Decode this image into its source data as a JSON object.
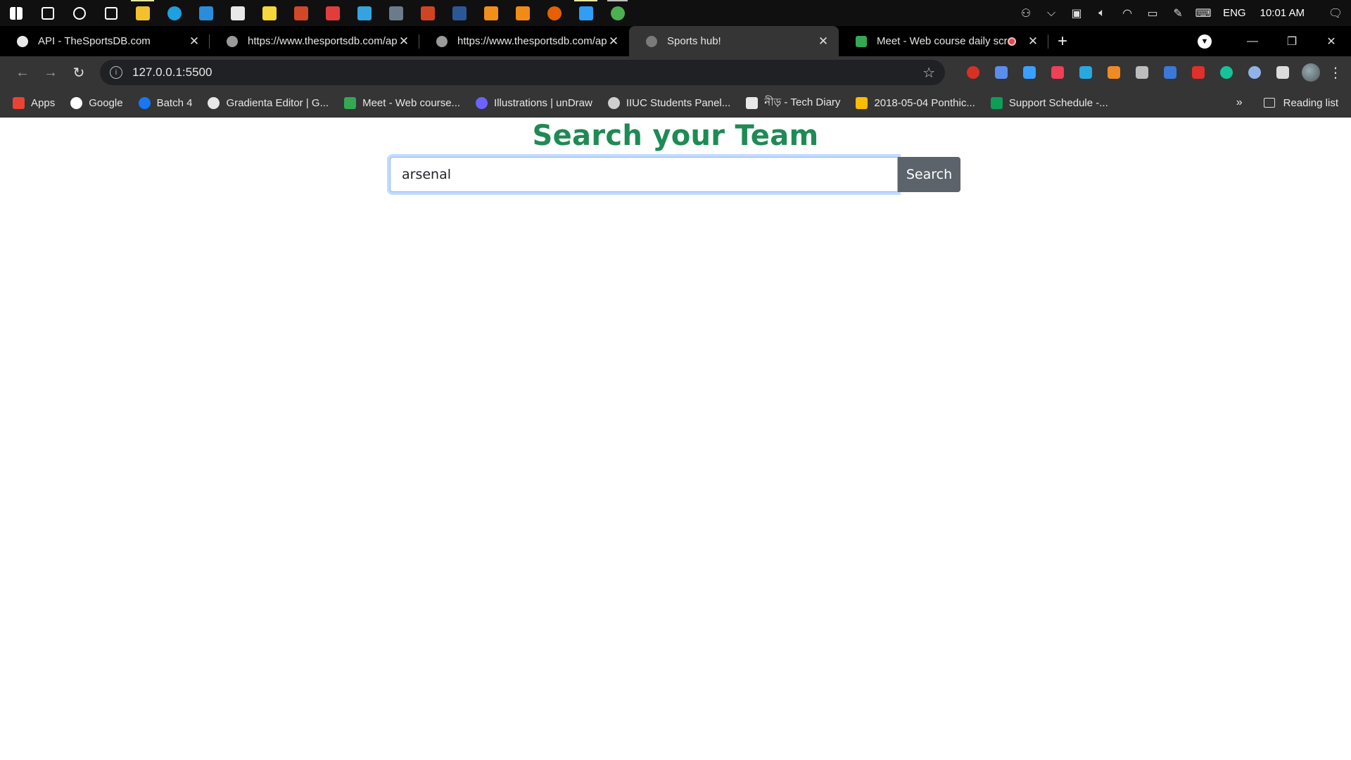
{
  "taskbar": {
    "apps": [
      {
        "name": "windows-start-icon",
        "color": "#ffffff"
      },
      {
        "name": "search-icon",
        "color": "#ffffff"
      },
      {
        "name": "cortana-icon",
        "color": "#ffffff"
      },
      {
        "name": "task-view-icon",
        "color": "#ffffff"
      },
      {
        "name": "file-explorer-icon",
        "color": "#f3c12d"
      },
      {
        "name": "edge-icon",
        "color": "#1fa0e0"
      },
      {
        "name": "mail-icon",
        "color": "#2a8ddb"
      },
      {
        "name": "store-icon",
        "color": "#e8e8e8"
      },
      {
        "name": "sticky-notes-icon",
        "color": "#f7d83a"
      },
      {
        "name": "office-icon",
        "color": "#d24726"
      },
      {
        "name": "media-icon",
        "color": "#e23d3d"
      },
      {
        "name": "snipping-icon",
        "color": "#35a3e0"
      },
      {
        "name": "calculator-icon",
        "color": "#6b7b8b"
      },
      {
        "name": "powerpoint-icon",
        "color": "#d04423"
      },
      {
        "name": "word-icon",
        "color": "#2b5797"
      },
      {
        "name": "sublime-icon",
        "color": "#f28e1a"
      },
      {
        "name": "vlc-icon",
        "color": "#f28a18"
      },
      {
        "name": "firefox-icon",
        "color": "#e66000"
      },
      {
        "name": "vscode-icon",
        "color": "#2f9ef4"
      },
      {
        "name": "chrome-icon",
        "color": "#4caf50"
      }
    ],
    "tray": {
      "language": "ENG",
      "time": "10:01 AM"
    }
  },
  "tabs": [
    {
      "title": "API - TheSportsDB.com",
      "favicon_color": "#e8e8e8"
    },
    {
      "title": "https://www.thesportsdb.com/ap",
      "favicon_color": "#9a9a9a"
    },
    {
      "title": "https://www.thesportsdb.com/ap",
      "favicon_color": "#9a9a9a"
    },
    {
      "title": "Sports hub!",
      "favicon_color": "#7a7a7a"
    },
    {
      "title": "Meet - Web course daily scru",
      "favicon_color": "#34a853"
    }
  ],
  "address_bar": {
    "url": "127.0.0.1:5500"
  },
  "extensions": [
    {
      "name": "blocker-extension-icon",
      "color": "#d93025"
    },
    {
      "name": "camera-extension-icon",
      "color": "#5b8def"
    },
    {
      "name": "new-extension-icon",
      "color": "#3aa0ff"
    },
    {
      "name": "pocket-extension-icon",
      "color": "#ef4056"
    },
    {
      "name": "translate-extension-icon",
      "color": "#29a8e0"
    },
    {
      "name": "orange-extension-icon",
      "color": "#f08a24"
    },
    {
      "name": "screenshot-extension-icon",
      "color": "#bdbdbd"
    },
    {
      "name": "accessibility-extension-icon",
      "color": "#3c78d8"
    },
    {
      "name": "video-extension-icon",
      "color": "#e0302a"
    },
    {
      "name": "grammarly-extension-icon",
      "color": "#15c39a"
    },
    {
      "name": "circle-extension-icon",
      "color": "#8fb4e8"
    },
    {
      "name": "puzzle-extensions-icon",
      "color": "#dddddd"
    }
  ],
  "bookmarks": [
    {
      "label": "Apps",
      "icon": "apps-grid-icon",
      "color": "#e94335"
    },
    {
      "label": "Google",
      "icon": "google-icon",
      "color": "#ffffff"
    },
    {
      "label": "Batch 4",
      "icon": "facebook-icon",
      "color": "#1877f2"
    },
    {
      "label": "Gradienta Editor | G...",
      "icon": "globe-icon",
      "color": "#e8e8e8"
    },
    {
      "label": "Meet - Web course...",
      "icon": "meet-icon",
      "color": "#34a853"
    },
    {
      "label": "Illustrations | unDraw",
      "icon": "undraw-icon",
      "color": "#6c63ff"
    },
    {
      "label": "IIUC Students Panel...",
      "icon": "iiuc-icon",
      "color": "#cfcfcf"
    },
    {
      "label": "নীড় - Tech Diary",
      "icon": "cup-icon",
      "color": "#e8e8e8"
    },
    {
      "label": "2018-05-04 Ponthic...",
      "icon": "drive-icon",
      "color": "#fbbc04"
    },
    {
      "label": "Support Schedule -...",
      "icon": "sheets-icon",
      "color": "#0f9d58"
    }
  ],
  "reading_list": "Reading list",
  "page": {
    "heading": "Search your Team",
    "search_value": "arsenal",
    "search_button": "Search",
    "heading_color": "#1f8a55",
    "button_color": "#5c636a"
  }
}
